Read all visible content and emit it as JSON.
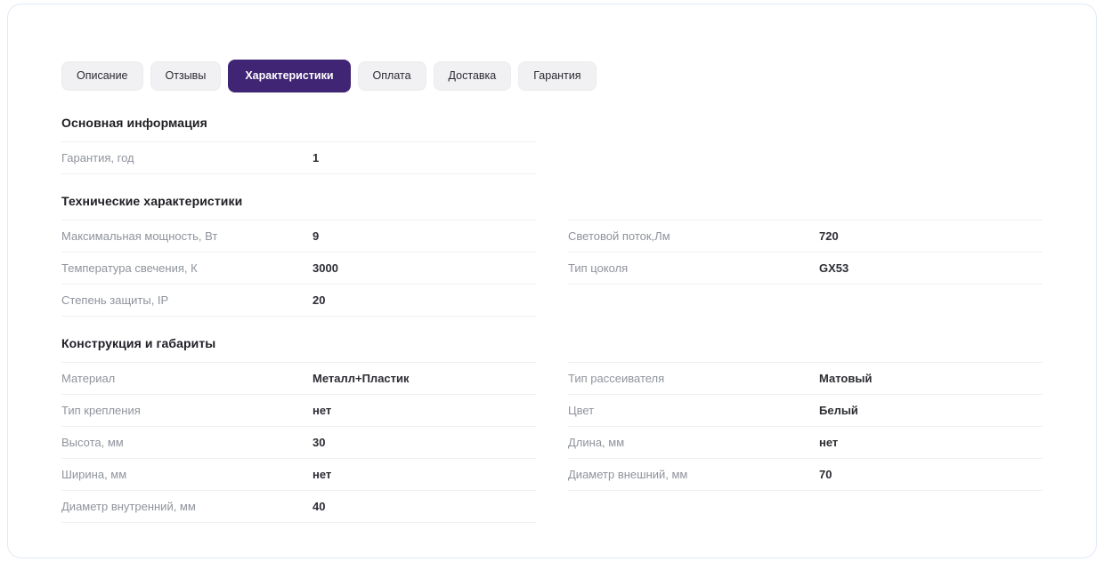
{
  "theme": {
    "accent": "#3f2573",
    "card_border": "#e2e8f5",
    "divider": "#eef0f4",
    "tab_inactive_bg": "#f1f1f4",
    "label_color": "#8f939c",
    "value_color": "#2c2d33"
  },
  "tabs": [
    {
      "label": "Описание",
      "active": false
    },
    {
      "label": "Отзывы",
      "active": false
    },
    {
      "label": "Характеристики",
      "active": true
    },
    {
      "label": "Оплата",
      "active": false
    },
    {
      "label": "Доставка",
      "active": false
    },
    {
      "label": "Гарантия",
      "active": false
    }
  ],
  "sections": [
    {
      "title": "Основная информация",
      "left": [
        {
          "label": "Гарантия, год",
          "value": "1"
        }
      ],
      "right": []
    },
    {
      "title": "Технические характеристики",
      "left": [
        {
          "label": "Максимальная мощность, Вт",
          "value": "9"
        },
        {
          "label": "Температура свечения, К",
          "value": "3000"
        },
        {
          "label": "Степень защиты, IP",
          "value": "20"
        }
      ],
      "right": [
        {
          "label": "Световой поток,Лм",
          "value": "720"
        },
        {
          "label": "Тип цоколя",
          "value": "GX53"
        }
      ]
    },
    {
      "title": "Конструкция и габариты",
      "left": [
        {
          "label": "Материал",
          "value": "Металл+Пластик"
        },
        {
          "label": "Тип крепления",
          "value": "нет"
        },
        {
          "label": "Высота, мм",
          "value": "30"
        },
        {
          "label": "Ширина, мм",
          "value": "нет"
        },
        {
          "label": "Диаметр внутренний, мм",
          "value": "40"
        }
      ],
      "right": [
        {
          "label": "Тип рассеивателя",
          "value": "Матовый"
        },
        {
          "label": "Цвет",
          "value": "Белый"
        },
        {
          "label": "Длина, мм",
          "value": "нет"
        },
        {
          "label": "Диаметр внешний, мм",
          "value": "70"
        }
      ]
    }
  ]
}
